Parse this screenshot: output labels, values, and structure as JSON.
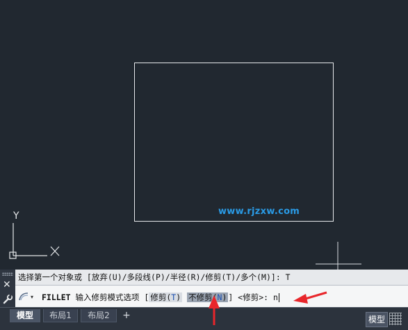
{
  "canvas": {
    "watermark": "www.rjzxw.com",
    "ucs_y_label": "Y"
  },
  "command_line": {
    "history_prefix": "选择第一个对象或 [",
    "history_options": [
      {
        "label": "放弃",
        "key": "U"
      },
      {
        "label": "多段线",
        "key": "P"
      },
      {
        "label": "半径",
        "key": "R"
      },
      {
        "label": "修剪",
        "key": "T"
      },
      {
        "label": "多个",
        "key": "M"
      }
    ],
    "history_suffix": "]: T",
    "history_full": "选择第一个对象或 [放弃(U)/多段线(P)/半径(R)/修剪(T)/多个(M)]: T",
    "prompt_command": "FILLET",
    "prompt_text": "输入修剪模式选项",
    "option_trim": "修剪",
    "option_trim_key": "T",
    "option_notrim": "不修剪",
    "option_notrim_key": "N",
    "default_value": "<修剪>:",
    "typed_value": "n",
    "close_label": "✕"
  },
  "tabs": {
    "items": [
      {
        "label": "模型",
        "active": true
      },
      {
        "label": "布局1",
        "active": false
      },
      {
        "label": "布局2",
        "active": false
      }
    ],
    "add_label": "+"
  },
  "status_bar": {
    "model_label": "模型"
  },
  "colors": {
    "canvas_bg": "#212830",
    "annotation_red": "#e8262b",
    "watermark_blue": "#2a9be6"
  }
}
